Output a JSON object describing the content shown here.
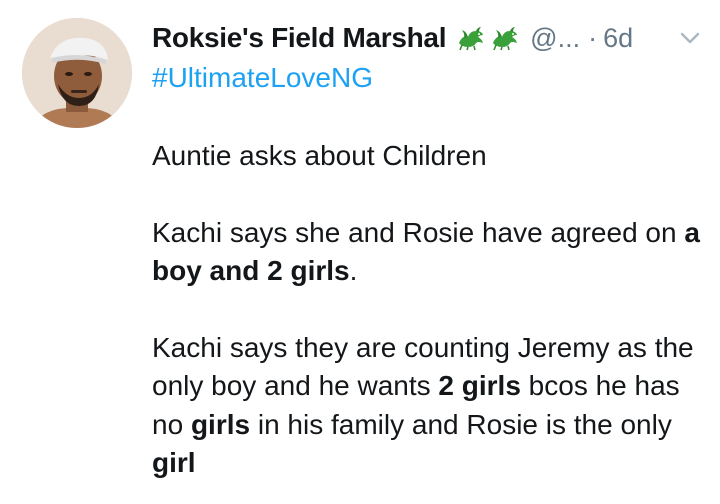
{
  "tweet": {
    "display_name": "Roksie's Field Marshal",
    "handle": "@...",
    "separator": "·",
    "time": "6d",
    "hashtag": "#UltimateLoveNG",
    "para1": "Auntie asks about Children",
    "para2": {
      "t1": "Kachi says she and Rosie have agreed on ",
      "b1": "a boy and 2 girls",
      "t2": "."
    },
    "para3": {
      "t1": "Kachi says they are counting Jeremy as the only boy and he wants ",
      "b1": "2 girls",
      "t2": " bcos he has no ",
      "b2": "girls",
      "t3": " in his family and Rosie is the only ",
      "b3": "girl"
    }
  },
  "icons": {
    "name_emojis": [
      "dragon-icon",
      "dragon-icon"
    ],
    "menu": "chevron-down-icon"
  },
  "colors": {
    "text": "#14171a",
    "secondary": "#657786",
    "link": "#1da1f2"
  }
}
